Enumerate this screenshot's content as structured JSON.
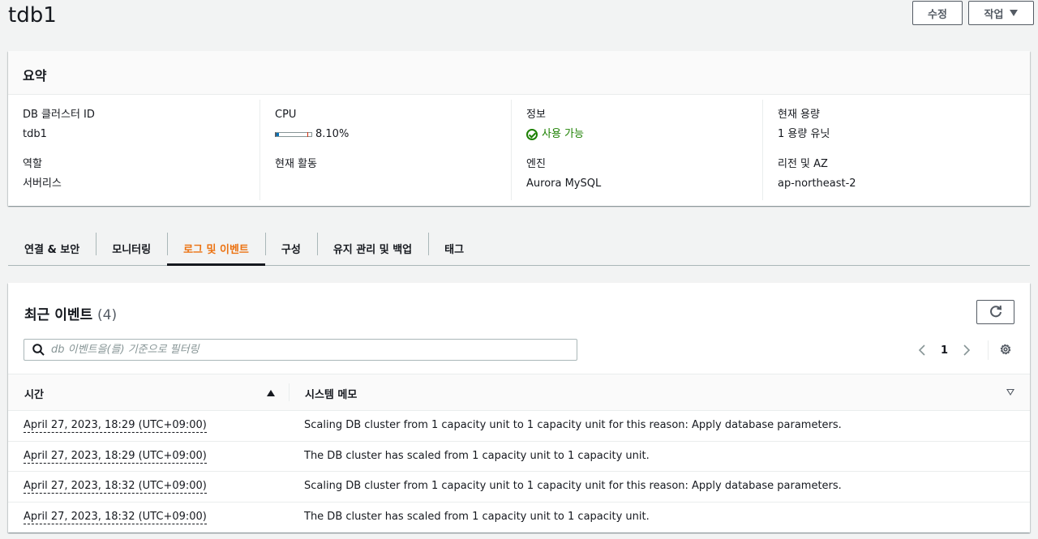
{
  "header": {
    "title": "tdb1",
    "edit_label": "수정",
    "action_label": "작업"
  },
  "summary": {
    "title": "요약",
    "cluster_id_label": "DB 클러스터 ID",
    "cluster_id": "tdb1",
    "role_label": "역할",
    "role": "서버리스",
    "cpu_label": "CPU",
    "cpu_value": "8.10%",
    "cpu_fraction": 0.081,
    "activity_label": "현재 활동",
    "info_label": "정보",
    "info_status": "사용 가능",
    "engine_label": "엔진",
    "engine": "Aurora MySQL",
    "capacity_label": "현재 용량",
    "capacity": "1 용량 유닛",
    "region_label": "리전 및 AZ",
    "region": "ap-northeast-2"
  },
  "tabs": [
    {
      "label": "연결 & 보안"
    },
    {
      "label": "모니터링"
    },
    {
      "label": "로그 및 이벤트",
      "active": true
    },
    {
      "label": "구성"
    },
    {
      "label": "유지 관리 및 백업"
    },
    {
      "label": "태그"
    }
  ],
  "events": {
    "title": "최근 이벤트",
    "count": "(4)",
    "search_placeholder": "db 이벤트을(를) 기준으로 필터링",
    "page": "1",
    "col_time": "시간",
    "col_memo": "시스템 메모",
    "rows": [
      {
        "time": "April 27, 2023, 18:29 (UTC+09:00)",
        "memo": "Scaling DB cluster from 1 capacity unit to 1 capacity unit for this reason: Apply database parameters."
      },
      {
        "time": "April 27, 2023, 18:29 (UTC+09:00)",
        "memo": "The DB cluster has scaled from 1 capacity unit to 1 capacity unit."
      },
      {
        "time": "April 27, 2023, 18:32 (UTC+09:00)",
        "memo": "Scaling DB cluster from 1 capacity unit to 1 capacity unit for this reason: Apply database parameters."
      },
      {
        "time": "April 27, 2023, 18:32 (UTC+09:00)",
        "memo": "The DB cluster has scaled from 1 capacity unit to 1 capacity unit."
      }
    ]
  },
  "colors": {
    "accent": "#ec7211",
    "success": "#1d8102",
    "border": "#eaeded"
  }
}
